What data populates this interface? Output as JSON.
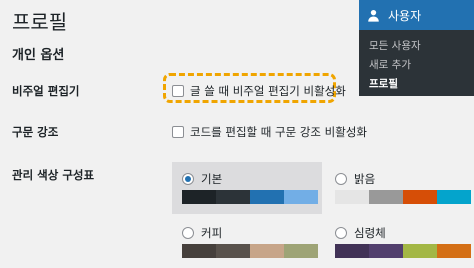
{
  "page_title": "프로필",
  "section_title": "개인 옵션",
  "rows": {
    "visual_editor": {
      "label": "비주얼 편집기",
      "checkbox_label": "글 쓸 때 비주얼 편집기 비활성화"
    },
    "syntax": {
      "label": "구문 강조",
      "checkbox_label": "코드를 편집할 때 구문 강조 비활성화"
    },
    "color_scheme": {
      "label": "관리 색상 구성표"
    }
  },
  "schemes": [
    {
      "name": "기본",
      "selected": true,
      "colors": [
        "#1d2327",
        "#2c3338",
        "#2271b1",
        "#72aee6"
      ]
    },
    {
      "name": "밝음",
      "selected": false,
      "colors": [
        "#e5e5e5",
        "#999999",
        "#d64e07",
        "#04a4cc"
      ]
    },
    {
      "name": "커피",
      "selected": false,
      "colors": [
        "#46403c",
        "#59524c",
        "#c7a589",
        "#9ea476"
      ]
    },
    {
      "name": "심령체",
      "selected": false,
      "colors": [
        "#413256",
        "#523f6d",
        "#a3b745",
        "#d46f15"
      ]
    }
  ],
  "user_menu": {
    "title": "사용자",
    "items": [
      "모든 사용자",
      "새로 추가",
      "프로필"
    ],
    "current_index": 2
  }
}
